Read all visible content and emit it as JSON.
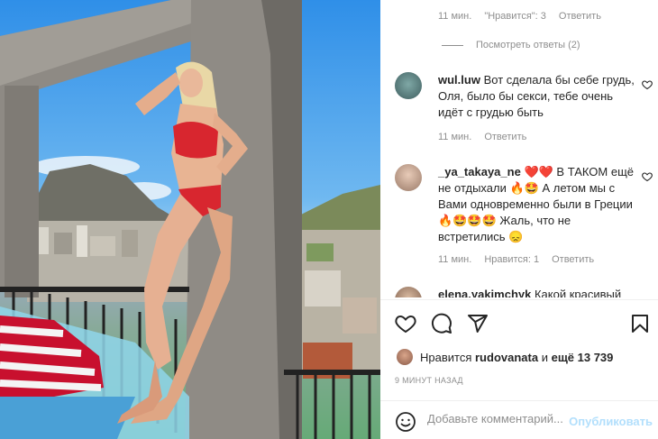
{
  "post_image": {
    "alt_semantics": "photo-woman-red-bikini-rooftop",
    "colors": {
      "sky": "#2f8fe8",
      "bikini": "#d8262f",
      "concrete": "#8a8580"
    }
  },
  "comments": [
    {
      "meta": {
        "time": "11 мин.",
        "likes": "\"Нравится\": 3",
        "reply": "Ответить"
      }
    },
    {
      "view_replies": "Посмотреть ответы (2)"
    },
    {
      "user": "wul.luw",
      "text": "Вот сделала бы себе грудь, Оля, было бы секси, тебе очень идёт с грудью быть",
      "meta": {
        "time": "11 мин.",
        "reply": "Ответить"
      }
    },
    {
      "user": "_ya_takaya_ne",
      "text": "❤️❤️ В ТАКОМ ещё не отдыхали 🔥🤩 А летом мы с Вами одновременно были в Греции 🔥🤩🤩🤩 Жаль, что не встретились 😞",
      "meta": {
        "time": "11 мин.",
        "likes": "Нравится: 1",
        "reply": "Ответить"
      }
    },
    {
      "user": "elena.yakimchyk",
      "text": "Какой красивый"
    }
  ],
  "actions": {
    "like_icon": "heart-outline-icon",
    "comment_icon": "comment-bubble-icon",
    "share_icon": "paper-plane-icon",
    "save_icon": "bookmark-icon"
  },
  "likes": {
    "prefix": "Нравится",
    "user": "rudovanata",
    "and_more": "и",
    "more_count": "ещё 13 739"
  },
  "time_ago": "9 МИНУТ НАЗАД",
  "add_comment": {
    "placeholder": "Добавьте комментарий...",
    "publish_label": "Опубликовать"
  }
}
